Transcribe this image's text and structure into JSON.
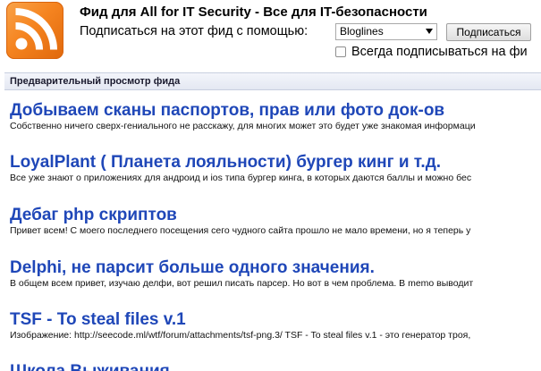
{
  "header": {
    "feed_title": "Фид для All for IT Security - Все для IT-безопасности",
    "subscribe_label": "Подписаться на этот фид с помощью:",
    "reader_selected": "Bloglines",
    "subscribe_button": "Подписаться",
    "always_checkbox_label": "Всегда подписываться на фи"
  },
  "preview_bar": {
    "label": "Предварительный просмотр фида"
  },
  "entries": [
    {
      "title": "Добываем сканы паспортов, прав или фото док-ов",
      "snippet": "Собственно ничего сверх-гениального не расскажу, для многих может это будет уже знакомая информаци"
    },
    {
      "title": "LoyalPlant ( Планета лояльности) бургер кинг и т.д.",
      "snippet": "Все уже знают о приложениях для андроид и ios типа бургер кинга, в которых даются баллы и можно бес"
    },
    {
      "title": "Дебаг php скриптов",
      "snippet": "Привет всем! С моего последнего посещения сего чудного сайта прошло не мало времени, но я теперь у"
    },
    {
      "title": "Delphi, не парсит больше одного значения.",
      "snippet": "В общем всем привет, изучаю делфи, вот решил писать парсер. Но вот в чем проблема. В memo выводит"
    },
    {
      "title": "TSF - To steal files v.1",
      "snippet": "Изображение: http://seecode.ml/wtf/forum/attachments/tsf-png.3/ TSF - To steal files v.1 - это генератор троя,"
    },
    {
      "title": "Школа Выживания",
      "snippet": ""
    }
  ],
  "colors": {
    "link": "#1f47b8",
    "rss_orange": "#f58420",
    "preview_bar": "#e4e8f2"
  }
}
